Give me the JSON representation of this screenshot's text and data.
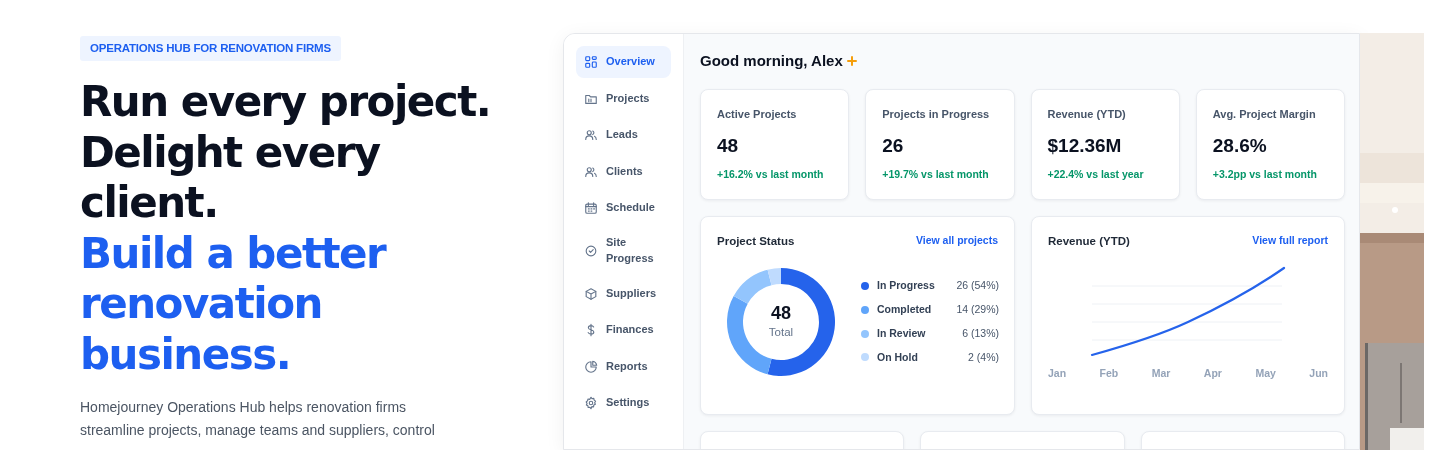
{
  "hero": {
    "eyebrow": "OPERATIONS HUB FOR RENOVATION FIRMS",
    "headline": [
      "Run every project.",
      "Delight every client."
    ],
    "headline_accent": "Build a better renovation business.",
    "description": "Homejourney Operations Hub helps renovation firms streamline projects, manage teams and suppliers, control"
  },
  "sidebar": {
    "items": [
      {
        "label": "Overview",
        "selected": true
      },
      {
        "label": "Projects",
        "selected": false
      },
      {
        "label": "Leads",
        "selected": false
      },
      {
        "label": "Clients",
        "selected": false
      },
      {
        "label": "Schedule",
        "selected": false
      },
      {
        "label": "Site Progress",
        "selected": false
      },
      {
        "label": "Suppliers",
        "selected": false
      },
      {
        "label": "Finances",
        "selected": false
      },
      {
        "label": "Reports",
        "selected": false
      },
      {
        "label": "Settings",
        "selected": false
      }
    ]
  },
  "greeting": "Good morning, Alex",
  "kpis": [
    {
      "label": "Active Projects",
      "value": "48",
      "change": "+16.2% vs last month"
    },
    {
      "label": "Projects in Progress",
      "value": "26",
      "change": "+19.7% vs last month"
    },
    {
      "label": "Revenue (YTD)",
      "value": "$12.36M",
      "change": "+22.4% vs last year"
    },
    {
      "label": "Avg. Project Margin",
      "value": "28.6%",
      "change": "+3.2pp vs last month"
    }
  ],
  "project_status": {
    "title": "Project Status",
    "link": "View all projects",
    "center_value": "48",
    "center_label": "Total",
    "legend": [
      {
        "value": "26 (54%)",
        "color": "#2563eb"
      },
      {
        "value": "14 (29%)",
        "color": "#60a5fa"
      },
      {
        "value": "6 (13%)",
        "color": "#93c5fd"
      },
      {
        "value": "2 (4%)",
        "color": "#bfdbfe"
      }
    ],
    "chart_data": {
      "type": "donut",
      "categories": [
        "In Progress",
        "Completed",
        "In Review",
        "On Hold"
      ],
      "values": [
        54,
        29,
        13,
        4
      ]
    }
  },
  "revenue": {
    "title": "Revenue (YTD)",
    "link": "View full report",
    "x_labels": [
      "Jan",
      "Feb",
      "Mar",
      "Apr",
      "May",
      "Jun"
    ]
  },
  "lower_cards": [
    {
      "kind": "empty"
    },
    {
      "kind": "empty"
    },
    {
      "kind": "empty"
    }
  ]
}
